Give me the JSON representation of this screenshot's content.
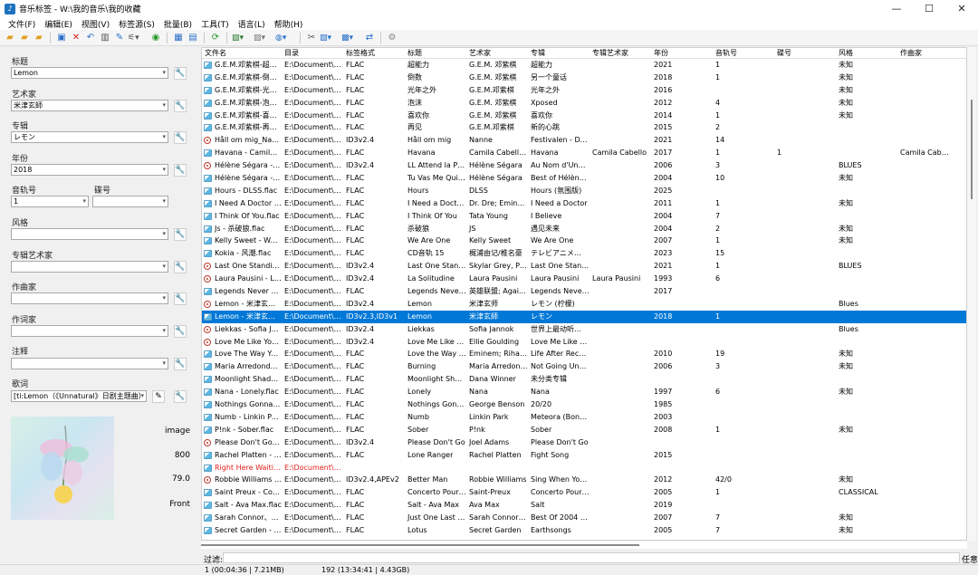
{
  "window": {
    "title": "音乐标签 - W:\\我的音乐\\我的收藏",
    "controls": [
      "—",
      "☐",
      "✕"
    ]
  },
  "menu": [
    "文件(F)",
    "编辑(E)",
    "视图(V)",
    "标签源(S)",
    "批量(B)",
    "工具(T)",
    "语言(L)",
    "帮助(H)"
  ],
  "toolbar": {
    "icons": [
      "folder-open",
      "folder-add",
      "folder-star",
      "save",
      "delete",
      "undo",
      "book",
      "magic",
      "filter",
      "refresh",
      "grid",
      "grid-alt",
      "sync",
      "image",
      "image-alt",
      "network",
      "tools",
      "doc",
      "multi",
      "convert",
      "settings"
    ]
  },
  "left_panel": {
    "labels": {
      "title": "标题",
      "artist": "艺术家",
      "album": "专辑",
      "year": "年份",
      "track": "音轨号",
      "disc": "碟号",
      "genre": "风格",
      "album_artist": "专辑艺术家",
      "composer": "作曲家",
      "lyricist": "作词家",
      "comment": "注释",
      "lyrics": "歌词"
    },
    "values": {
      "title": "Lemon",
      "artist": "米津玄師",
      "album": "レモン",
      "year": "2018",
      "track": "1",
      "disc": "",
      "genre": "",
      "album_artist": "",
      "composer": "",
      "lyricist": "",
      "comment": "",
      "lyrics": "[ti:Lemon（《Unnatural》日剧主题曲）"
    },
    "cover_info": [
      "image",
      "800",
      "79.0",
      "Front"
    ]
  },
  "list": {
    "headers": [
      "文件名",
      "目录",
      "标签格式",
      "标题",
      "艺术家",
      "专辑",
      "专辑艺术家",
      "年份",
      "音轨号",
      "碟号",
      "风格",
      "作曲家"
    ],
    "rows": [
      {
        "c": [
          "G.E.M.邓紫棋-超能力.…",
          "E:\\Document\\M…",
          "FLAC",
          "超能力",
          "G.E.M. 邓紫棋",
          "超能力",
          "",
          "2021",
          "1",
          "",
          "未知",
          ""
        ],
        "t": "flac"
      },
      {
        "c": [
          "G.E.M.邓紫棋-倒数.flac",
          "E:\\Document\\M…",
          "FLAC",
          "倒数",
          "G.E.M. 邓紫棋",
          "另一个童话",
          "",
          "2018",
          "1",
          "",
          "未知",
          ""
        ],
        "t": "flac"
      },
      {
        "c": [
          "G.E.M.邓紫棋-光年之…",
          "E:\\Document\\M…",
          "FLAC",
          "光年之外",
          "G.E.M.邓紫棋",
          "光年之外",
          "",
          "2016",
          "",
          "",
          "未知",
          ""
        ],
        "t": "flac"
      },
      {
        "c": [
          "G.E.M.邓紫棋-泡沫.flac",
          "E:\\Document\\M…",
          "FLAC",
          "泡沫",
          "G.E.M. 邓紫棋",
          "Xposed",
          "",
          "2012",
          "4",
          "",
          "未知",
          ""
        ],
        "t": "flac"
      },
      {
        "c": [
          "G.E.M.邓紫棋-喜欢你…",
          "E:\\Document\\M…",
          "FLAC",
          "喜欢你",
          "G.E.M. 邓紫棋",
          "喜欢你",
          "",
          "2014",
          "1",
          "",
          "未知",
          ""
        ],
        "t": "flac"
      },
      {
        "c": [
          "G.E.M.邓紫棋-再见.flac",
          "E:\\Document\\M…",
          "FLAC",
          "再见",
          "G.E.M.邓紫棋",
          "新的心跳",
          "",
          "2015",
          "2",
          "",
          "",
          ""
        ],
        "t": "flac"
      },
      {
        "c": [
          "Håll om mig_Nanne.…",
          "E:\\Document\\M…",
          "ID3v2.4",
          "Håll om mig",
          "Nanne",
          "Festivalen - De…",
          "",
          "2021",
          "14",
          "",
          "",
          ""
        ],
        "t": "mp3"
      },
      {
        "c": [
          "Havana - Camila Cab…",
          "E:\\Document\\M…",
          "FLAC",
          "Havana",
          "Camila Cabello;…",
          "Havana",
          "Camila Cabello",
          "2017",
          "1",
          "1",
          "",
          "Camila Cabello/…"
        ],
        "t": "flac"
      },
      {
        "c": [
          "Hélène Ségara - Ll At…",
          "E:\\Document\\M…",
          "ID3v2.4",
          "LL Attend la Pluie",
          "Hélène Ségara",
          "Au Nom d'Une …",
          "",
          "2006",
          "3",
          "",
          "BLUES",
          ""
        ],
        "t": "mp3"
      },
      {
        "c": [
          "Hélène Ségara - Tu V…",
          "E:\\Document\\M…",
          "FLAC",
          "Tu Vas Me Quit…",
          "Hélène Ségara",
          "Best of Hélène …",
          "",
          "2004",
          "10",
          "",
          "未知",
          ""
        ],
        "t": "flac"
      },
      {
        "c": [
          "Hours - DLSS.flac",
          "E:\\Document\\M…",
          "FLAC",
          "Hours",
          "DLSS",
          "Hours (氛围版)",
          "",
          "2025",
          "",
          "",
          "",
          ""
        ],
        "t": "flac"
      },
      {
        "c": [
          "I Need A Doctor - Dr…",
          "E:\\Document\\M…",
          "FLAC",
          "I Need a Docto…",
          "Dr. Dre; Emine…",
          "I Need a Doctor",
          "",
          "2011",
          "1",
          "",
          "未知",
          ""
        ],
        "t": "flac"
      },
      {
        "c": [
          "I Think Of You.flac",
          "E:\\Document\\M…",
          "FLAC",
          "I Think Of You",
          "Tata Young",
          "I Believe",
          "",
          "2004",
          "7",
          "",
          "",
          ""
        ],
        "t": "flac"
      },
      {
        "c": [
          "Js - 杀破狼.flac",
          "E:\\Document\\M…",
          "FLAC",
          "杀破狼",
          "JS",
          "遇见未来",
          "",
          "2004",
          "2",
          "",
          "未知",
          ""
        ],
        "t": "flac"
      },
      {
        "c": [
          "Kelly Sweet - We Are…",
          "E:\\Document\\M…",
          "FLAC",
          "We Are One",
          "Kelly Sweet",
          "We Are One",
          "",
          "2007",
          "1",
          "",
          "未知",
          ""
        ],
        "t": "flac"
      },
      {
        "c": [
          "Kokia - 风潮.flac",
          "E:\\Document\\M…",
          "FLAC",
          "CD音轨 15",
          "梶浦由记/椎名豪",
          "テレビアニメ…",
          "",
          "2023",
          "15",
          "",
          "",
          ""
        ],
        "t": "flac"
      },
      {
        "c": [
          "Last One Standing - …",
          "E:\\Document\\M…",
          "ID3v2.4",
          "Last One Stand…",
          "Skylar Grey, Po…",
          "Last One Stand…",
          "",
          "2021",
          "1",
          "",
          "BLUES",
          ""
        ],
        "t": "mp3"
      },
      {
        "c": [
          "Laura Pausini - La Sol…",
          "E:\\Document\\M…",
          "ID3v2.4",
          "La Solitudine",
          "Laura Pausini",
          "Laura Pausini",
          "Laura Pausini",
          "1993",
          "6",
          "",
          "",
          ""
        ],
        "t": "mp3"
      },
      {
        "c": [
          "Legends Never Die - …",
          "E:\\Document\\M…",
          "FLAC",
          "Legends Never …",
          "英雄联盟; Agai…",
          "Legends Never …",
          "",
          "2017",
          "",
          "",
          "",
          ""
        ],
        "t": "flac"
      },
      {
        "c": [
          "Lemon - 米津玄師.mp3",
          "E:\\Document\\M…",
          "ID3v2.4",
          "Lemon",
          "米津玄师",
          "レモン (柠檬)",
          "",
          "",
          "",
          "",
          "Blues",
          ""
        ],
        "t": "mp3"
      },
      {
        "c": [
          "Lemon - 米津玄師Liv…",
          "E:\\Document\\M…",
          "ID3v2.3,ID3v1",
          "Lemon",
          "米津玄師",
          "レモン",
          "",
          "2018",
          "1",
          "",
          "",
          ""
        ],
        "t": "flac",
        "selected": true
      },
      {
        "c": [
          "Liekkas - Sofia Janno…",
          "E:\\Document\\M…",
          "ID3v2.4",
          "Liekkas",
          "Sofia Jannok",
          "世界上最动听…",
          "",
          "",
          "",
          "",
          "Blues",
          ""
        ],
        "t": "mp3"
      },
      {
        "c": [
          "Love Me Like You Do…",
          "E:\\Document\\M…",
          "ID3v2.4",
          "Love Me Like Y…",
          "Ellie Goulding",
          "Love Me Like Y…",
          "",
          "",
          "",
          "",
          "",
          ""
        ],
        "t": "mp3"
      },
      {
        "c": [
          "Love The Way You Li…",
          "E:\\Document\\M…",
          "FLAC",
          "Love the Way …",
          "Eminem; Rihanna",
          "Life After Reco…",
          "",
          "2010",
          "19",
          "",
          "未知",
          ""
        ],
        "t": "flac"
      },
      {
        "c": [
          "Maria Arredondo-Bur…",
          "E:\\Document\\M…",
          "FLAC",
          "Burning",
          "Maria Arredondo",
          "Not Going Under",
          "",
          "2006",
          "3",
          "",
          "未知",
          ""
        ],
        "t": "flac"
      },
      {
        "c": [
          "Moonlight Shadow - …",
          "E:\\Document\\M…",
          "FLAC",
          "Moonlight Shad…",
          "Dana Winner",
          "未分类专辑",
          "",
          "",
          "",
          "",
          "",
          ""
        ],
        "t": "flac"
      },
      {
        "c": [
          "Nana - Lonely.flac",
          "E:\\Document\\M…",
          "FLAC",
          "Lonely",
          "Nana",
          "Nana",
          "",
          "1997",
          "6",
          "",
          "未知",
          ""
        ],
        "t": "flac"
      },
      {
        "c": [
          "Nothings Gonna Chan…",
          "E:\\Document\\M…",
          "FLAC",
          "Nothings Gonn…",
          "George Benson",
          "20/20",
          "",
          "1985",
          "",
          "",
          "",
          ""
        ],
        "t": "flac"
      },
      {
        "c": [
          "Numb - Linkin Park.flac",
          "E:\\Document\\M…",
          "FLAC",
          "Numb",
          "Linkin Park",
          "Meteora (Bonu…",
          "",
          "2003",
          "",
          "",
          "",
          ""
        ],
        "t": "flac"
      },
      {
        "c": [
          "P!nk - Sober.flac",
          "E:\\Document\\M…",
          "FLAC",
          "Sober",
          "P!nk",
          "Sober",
          "",
          "2008",
          "1",
          "",
          "未知",
          ""
        ],
        "t": "flac"
      },
      {
        "c": [
          "Please Don't Go - Joe…",
          "E:\\Document\\M…",
          "ID3v2.4",
          "Please Don't Go",
          "Joel Adams",
          "Please Don't Go",
          "",
          "",
          "",
          "",
          "",
          ""
        ],
        "t": "mp3"
      },
      {
        "c": [
          "Rachel Platten - Figh…",
          "E:\\Document\\M…",
          "FLAC",
          "Lone Ranger",
          "Rachel Platten",
          "Fight Song",
          "",
          "2015",
          "",
          "",
          "",
          ""
        ],
        "t": "flac"
      },
      {
        "c": [
          "Right Here Waiting - …",
          "E:\\Document\\M…",
          "",
          "",
          "",
          "",
          "",
          "",
          "",
          "",
          "",
          ""
        ],
        "t": "flac",
        "red": true
      },
      {
        "c": [
          "Robbie Williams - Bet…",
          "E:\\Document\\M…",
          "ID3v2.4,APEv2",
          "Better Man",
          "Robbie Williams",
          "Sing When You'…",
          "",
          "2012",
          "42/0",
          "",
          "未知",
          ""
        ],
        "t": "mp3"
      },
      {
        "c": [
          "Saint Preux - Concert…",
          "E:\\Document\\M…",
          "FLAC",
          "Concerto Pour …",
          "Saint-Preux",
          "Concerto Pour …",
          "",
          "2005",
          "1",
          "",
          "CLASSICAL",
          ""
        ],
        "t": "flac"
      },
      {
        "c": [
          "Salt - Ava Max.flac",
          "E:\\Document\\M…",
          "FLAC",
          "Salt - Ava Max",
          "Ava Max",
          "Salt",
          "",
          "2019",
          "",
          "",
          "",
          ""
        ],
        "t": "flac"
      },
      {
        "c": [
          "Sarah Connor、natur…",
          "E:\\Document\\M…",
          "FLAC",
          "Just One Last …",
          "Sarah Connor; …",
          "Best Of 2004 T…",
          "",
          "2007",
          "7",
          "",
          "未知",
          ""
        ],
        "t": "flac"
      },
      {
        "c": [
          "Secret Garden - Lotu…",
          "E:\\Document\\M…",
          "FLAC",
          "Lotus",
          "Secret Garden",
          "Earthsongs",
          "",
          "2005",
          "7",
          "",
          "未知",
          ""
        ],
        "t": "flac"
      }
    ]
  },
  "filter": {
    "label": "过滤:",
    "right": "任意"
  },
  "status": {
    "selected": "1 (00:04:36 | 7.21MB)",
    "total": "192 (13:34:41 | 4.43GB)"
  }
}
